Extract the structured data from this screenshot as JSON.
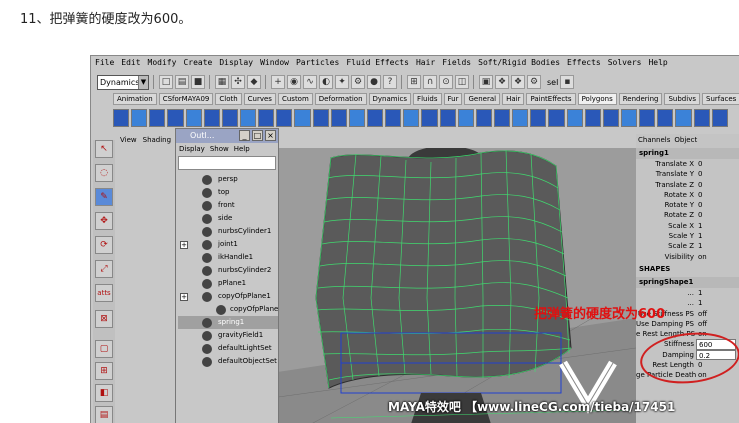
{
  "caption": "11、把弹簧的硬度改为600。",
  "menu": [
    "File",
    "Edit",
    "Modify",
    "Create",
    "Display",
    "Window",
    "Particles",
    "Fluid Effects",
    "Hair",
    "Fields",
    "Soft/Rigid Bodies",
    "Effects",
    "Solvers",
    "Help"
  ],
  "mode_dropdown": "Dynamics",
  "sel_label": "sel",
  "shelf_tabs": [
    "Animation",
    "CSforMAYA09",
    "Cloth",
    "Curves",
    "Custom",
    "Deformation",
    "Dynamics",
    "Fluids",
    "Fur",
    "General",
    "Hair",
    "PaintEffects",
    "Polygons",
    "Rendering",
    "Subdivs",
    "Surfaces"
  ],
  "active_shelf_tab": "Polygons",
  "viewport_menu": [
    "View",
    "Shading"
  ],
  "outliner": {
    "title": "Outl...",
    "menu": [
      "Display",
      "Show",
      "Help"
    ],
    "items": [
      {
        "label": "persp",
        "expand": false,
        "selected": false,
        "indent": false
      },
      {
        "label": "top",
        "expand": false,
        "selected": false,
        "indent": false
      },
      {
        "label": "front",
        "expand": false,
        "selected": false,
        "indent": false
      },
      {
        "label": "side",
        "expand": false,
        "selected": false,
        "indent": false
      },
      {
        "label": "nurbsCylinder1",
        "expand": false,
        "selected": false,
        "indent": false
      },
      {
        "label": "joint1",
        "expand": true,
        "selected": false,
        "indent": false
      },
      {
        "label": "ikHandle1",
        "expand": false,
        "selected": false,
        "indent": false
      },
      {
        "label": "nurbsCylinder2",
        "expand": false,
        "selected": false,
        "indent": false
      },
      {
        "label": "pPlane1",
        "expand": false,
        "selected": false,
        "indent": false
      },
      {
        "label": "copyOfpPlane1",
        "expand": true,
        "selected": false,
        "indent": false
      },
      {
        "label": "copyOfpPlane",
        "expand": false,
        "selected": false,
        "indent": true
      },
      {
        "label": "spring1",
        "expand": false,
        "selected": true,
        "indent": false
      },
      {
        "label": "gravityField1",
        "expand": false,
        "selected": false,
        "indent": false
      },
      {
        "label": "defaultLightSet",
        "expand": false,
        "selected": false,
        "indent": false
      },
      {
        "label": "defaultObjectSet",
        "expand": false,
        "selected": false,
        "indent": false
      }
    ]
  },
  "channel_box": {
    "header": [
      "Channels",
      "Object"
    ],
    "node": "spring1",
    "attrs": [
      {
        "k": "Translate X",
        "v": "0"
      },
      {
        "k": "Translate Y",
        "v": "0"
      },
      {
        "k": "Translate Z",
        "v": "0"
      },
      {
        "k": "Rotate X",
        "v": "0"
      },
      {
        "k": "Rotate Y",
        "v": "0"
      },
      {
        "k": "Rotate Z",
        "v": "0"
      },
      {
        "k": "Scale X",
        "v": "1"
      },
      {
        "k": "Scale Y",
        "v": "1"
      },
      {
        "k": "Scale Z",
        "v": "1"
      },
      {
        "k": "Visibility",
        "v": "on"
      }
    ],
    "shapes_label": "SHAPES",
    "shape_node": "springShape1",
    "shape_attrs": [
      {
        "k": "...",
        "v": "1"
      },
      {
        "k": "...",
        "v": "1"
      },
      {
        "k": "Use Stiffness PS",
        "v": "off"
      },
      {
        "k": "Use Damping PS",
        "v": "off"
      },
      {
        "k": "e Rest Length PS",
        "v": "on"
      },
      {
        "k": "Stiffness",
        "v": "600",
        "boxed": true
      },
      {
        "k": "Damping",
        "v": "0.2",
        "boxed": true
      },
      {
        "k": "Rest Length",
        "v": "0"
      },
      {
        "k": "ge Particle Death",
        "v": "on"
      }
    ]
  },
  "annotation": "把弹簧的硬度改为600",
  "watermark": "MAYA特效吧 【www.lineCG.com/tieba/17451",
  "colors": {
    "annotation": "#e01010",
    "mesh": "#3fe070",
    "viewport_bg": "#9c9c9c"
  }
}
